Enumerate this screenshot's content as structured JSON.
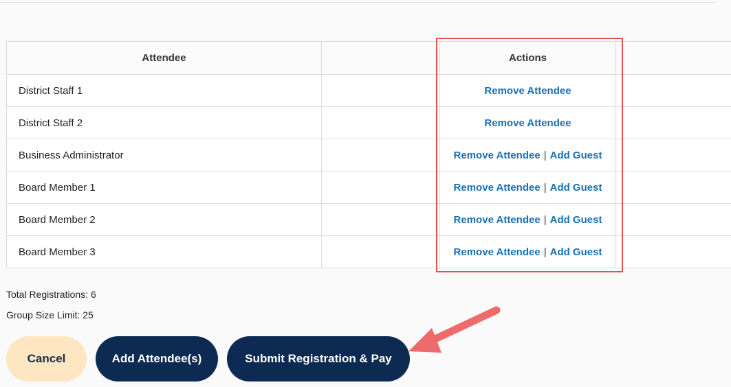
{
  "table": {
    "headers": {
      "attendee": "Attendee",
      "actions": "Actions"
    },
    "rows": [
      {
        "name": "District Staff 1",
        "remove": "Remove Attendee",
        "separator": "",
        "guest": ""
      },
      {
        "name": "District Staff 2",
        "remove": "Remove Attendee",
        "separator": "",
        "guest": ""
      },
      {
        "name": "Business Administrator",
        "remove": "Remove Attendee",
        "separator": "|",
        "guest": "Add Guest"
      },
      {
        "name": "Board Member 1",
        "remove": "Remove Attendee",
        "separator": "|",
        "guest": "Add Guest"
      },
      {
        "name": "Board Member 2",
        "remove": "Remove Attendee",
        "separator": "|",
        "guest": "Add Guest"
      },
      {
        "name": "Board Member 3",
        "remove": "Remove Attendee",
        "separator": "|",
        "guest": "Add Guest"
      }
    ]
  },
  "summary": {
    "total_registrations": "Total Registrations: 6",
    "group_size_limit": "Group Size Limit: 25"
  },
  "buttons": {
    "cancel": "Cancel",
    "add_attendees": "Add Attendee(s)",
    "submit": "Submit Registration & Pay"
  },
  "annotation": {
    "highlight_color": "#e45151",
    "arrow_color": "#ef6a6a"
  }
}
